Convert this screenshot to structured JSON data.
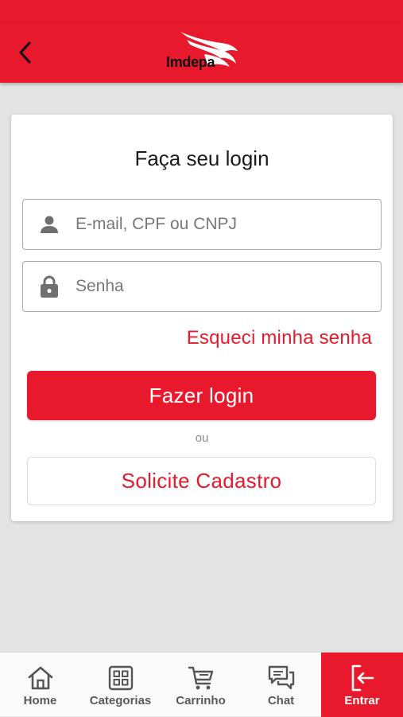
{
  "header": {
    "back_icon": "chevron-left-icon",
    "logo_text": "Imdepa",
    "brand_color": "#e8192c"
  },
  "login": {
    "title": "Faça seu login",
    "email_placeholder": "E-mail, CPF ou CNPJ",
    "email_icon": "person-icon",
    "password_placeholder": "Senha",
    "password_icon": "lock-icon",
    "forgot_label": "Esqueci minha senha",
    "login_button": "Fazer login",
    "or_label": "ou",
    "register_button": "Solicite Cadastro"
  },
  "tabbar": {
    "items": [
      {
        "label": "Home",
        "icon": "home-icon"
      },
      {
        "label": "Categorias",
        "icon": "grid-icon"
      },
      {
        "label": "Carrinho",
        "icon": "cart-icon"
      },
      {
        "label": "Chat",
        "icon": "chat-icon"
      },
      {
        "label": "Entrar",
        "icon": "login-icon",
        "active": true
      }
    ]
  }
}
